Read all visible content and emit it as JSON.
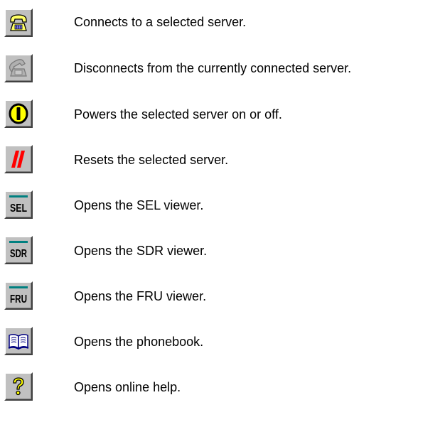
{
  "toolbar_legend": {
    "items": [
      {
        "icon": "phone-connect-icon",
        "description": "Connects to a selected server."
      },
      {
        "icon": "phone-disconnect-icon",
        "description": "Disconnects from the currently connected server."
      },
      {
        "icon": "power-icon",
        "description": "Powers the selected server on or off."
      },
      {
        "icon": "reset-icon",
        "description": "Resets the selected server."
      },
      {
        "icon": "sel-viewer-icon",
        "label": "SEL",
        "description": "Opens the SEL viewer."
      },
      {
        "icon": "sdr-viewer-icon",
        "label": "SDR",
        "description": "Opens the SDR viewer."
      },
      {
        "icon": "fru-viewer-icon",
        "label": "FRU",
        "description": "Opens the FRU viewer."
      },
      {
        "icon": "phonebook-icon",
        "description": "Opens the phonebook."
      },
      {
        "icon": "help-icon",
        "description": "Opens online help."
      }
    ]
  },
  "colors": {
    "button_face": "#c0c0c0",
    "phone_yellow": "#ffff66",
    "phone_outline": "#000000",
    "disabled_gray": "#9a9a9a",
    "power_yellow": "#ffff00",
    "reset_red": "#ff0000",
    "viewer_bar": "#008080",
    "help_yellow": "#ffff00",
    "book_blue": "#000080",
    "text": "#000000"
  }
}
